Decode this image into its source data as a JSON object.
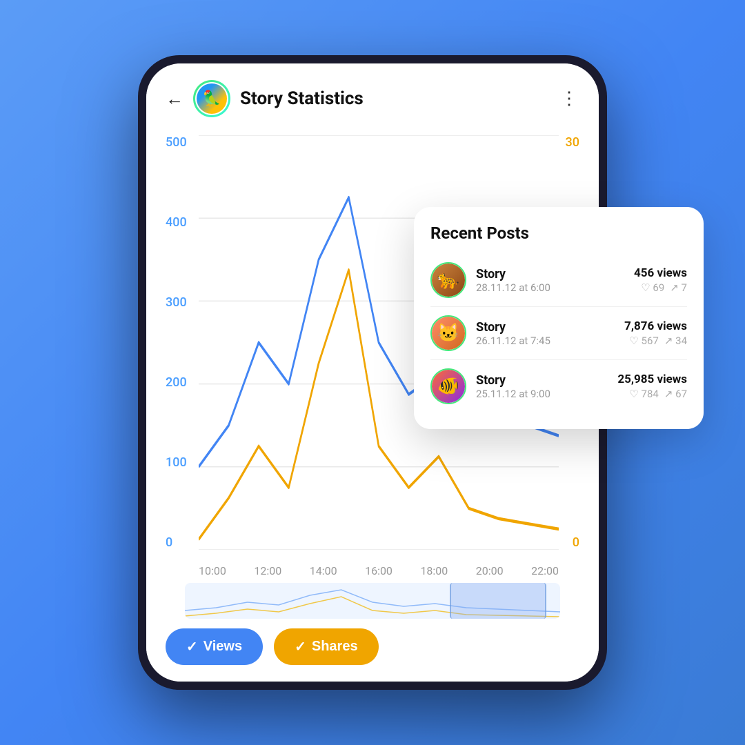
{
  "page": {
    "background": "#4285f4"
  },
  "header": {
    "back_label": "←",
    "title": "Story Statistics",
    "more_icon": "⋮",
    "avatar_emoji": "🦜"
  },
  "chart": {
    "y_labels_blue": [
      "0",
      "100",
      "200",
      "300",
      "400",
      "500"
    ],
    "y_labels_gold_top": "30",
    "y_labels_gold_bottom": "0",
    "x_labels": [
      "10:00",
      "12:00",
      "14:00",
      "16:00",
      "18:00",
      "20:00",
      "22:00"
    ]
  },
  "buttons": {
    "views_label": "✓ Views",
    "shares_label": "✓ Shares"
  },
  "recent_posts": {
    "title": "Recent Posts",
    "posts": [
      {
        "name": "Story",
        "date": "28.11.12 at 6:00",
        "views": "456 views",
        "likes": "69",
        "shares": "7",
        "animal": "leopard",
        "emoji": "🐆"
      },
      {
        "name": "Story",
        "date": "26.11.12 at 7:45",
        "views": "7,876 views",
        "likes": "567",
        "shares": "34",
        "animal": "cat",
        "emoji": "🐱"
      },
      {
        "name": "Story",
        "date": "25.11.12 at 9:00",
        "views": "25,985 views",
        "likes": "784",
        "shares": "67",
        "animal": "clownfish",
        "emoji": "🐠"
      }
    ]
  }
}
